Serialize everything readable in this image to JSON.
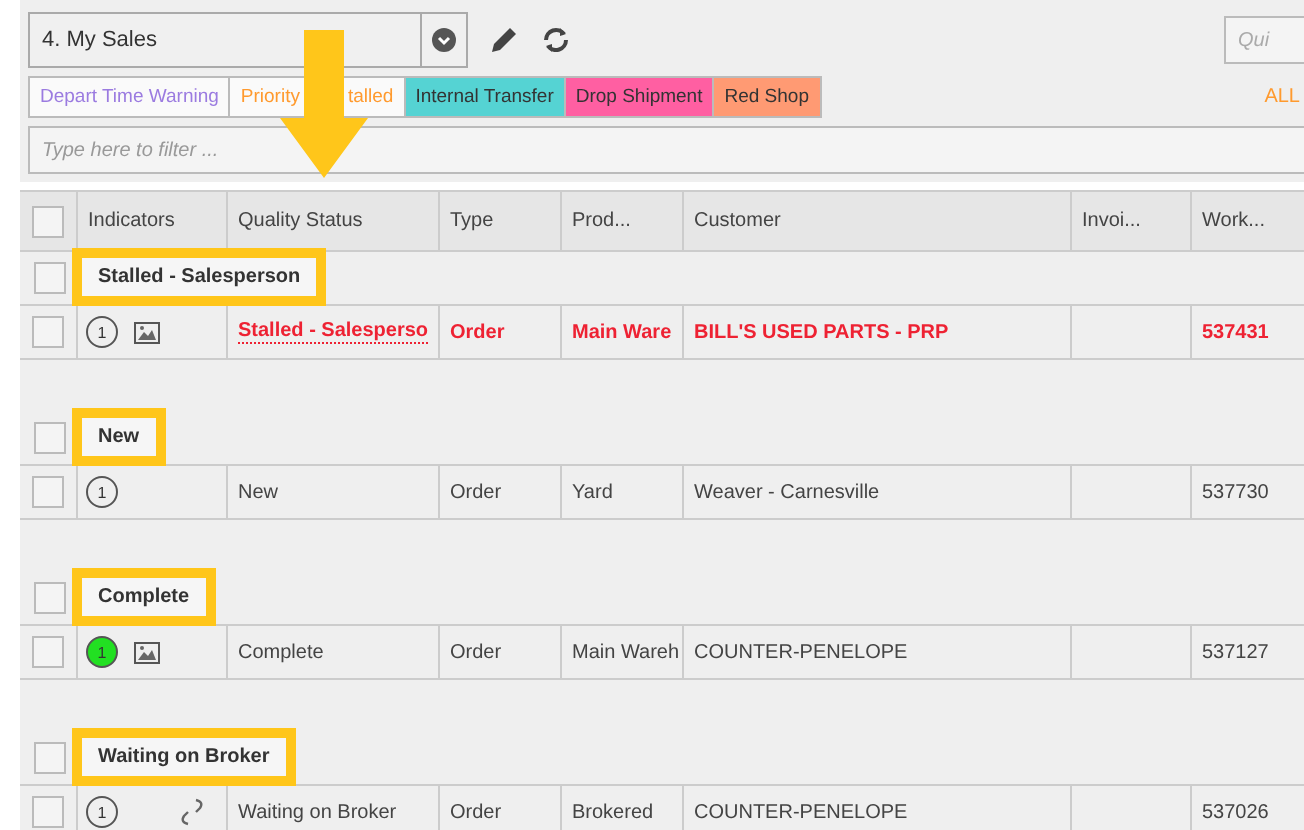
{
  "view_select": {
    "value": "4. My Sales"
  },
  "quick_search": {
    "placeholder": "Qui"
  },
  "tags": [
    {
      "kind": "outline",
      "color": "#9b7be0",
      "parts": [
        "Depart Time Warning"
      ]
    },
    {
      "kind": "outline",
      "color": "#ff9a2e",
      "parts": [
        "Priority",
        "talled"
      ]
    },
    {
      "kind": "filled",
      "color": "#55d3d3",
      "parts": [
        "Internal Transfer"
      ]
    },
    {
      "kind": "filled",
      "color": "#ff5fa2",
      "parts": [
        "Drop Shipment"
      ]
    },
    {
      "kind": "filled",
      "color": "#ff9a73",
      "parts": [
        "Red Shop"
      ]
    }
  ],
  "all_link": "ALL",
  "filter": {
    "placeholder": "Type here to filter ..."
  },
  "table": {
    "select_all": {
      "checked": false
    },
    "columns": [
      "Indicators",
      "Quality Status",
      "Type",
      "Prod...",
      "Customer",
      "Invoi...",
      "Work..."
    ],
    "groups": [
      {
        "label": "Stalled - Salesperson",
        "checked": false,
        "rows": [
          {
            "checked": false,
            "alert": true,
            "count": "1",
            "kind": "image",
            "cells": [
              "Stalled - Salesperso",
              "Order",
              "Main Ware",
              "BILL'S USED PARTS - PRP",
              "537431"
            ]
          }
        ]
      },
      {
        "label": "New",
        "checked": false,
        "rows": [
          {
            "checked": false,
            "alert": false,
            "count": "1",
            "kind": "plain",
            "cells": [
              "New",
              "Order",
              "Yard",
              "Weaver - Carnesville",
              "537730"
            ]
          }
        ]
      },
      {
        "label": "Complete",
        "checked": false,
        "rows": [
          {
            "checked": false,
            "alert": false,
            "count": "1",
            "color": "#22e022",
            "kind": "image",
            "cells": [
              "Complete",
              "Order",
              "Main Wareh",
              "COUNTER-PENELOPE",
              "537127"
            ]
          }
        ]
      },
      {
        "label": "Waiting on Broker",
        "checked": false,
        "rows": [
          {
            "checked": false,
            "alert": false,
            "count": "1",
            "kind": "link",
            "cells": [
              "Waiting on Broker",
              "Order",
              "Brokered",
              "COUNTER-PENELOPE",
              "537026"
            ]
          }
        ]
      }
    ]
  }
}
